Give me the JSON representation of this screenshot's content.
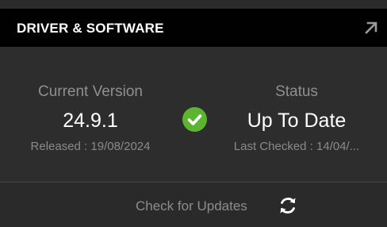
{
  "header": {
    "title": "DRIVER & SOFTWARE",
    "expand_icon": "arrow-up-right-icon"
  },
  "current_version": {
    "label": "Current Version",
    "value": "24.9.1",
    "released": "Released : 19/08/2024"
  },
  "status": {
    "label": "Status",
    "value": "Up To Date",
    "last_checked": "Last Checked : 14/04/...",
    "icon": "check-circle-icon",
    "icon_color": "#5cb531"
  },
  "footer": {
    "check_updates_label": "Check for Updates",
    "icon": "refresh-icon"
  }
}
